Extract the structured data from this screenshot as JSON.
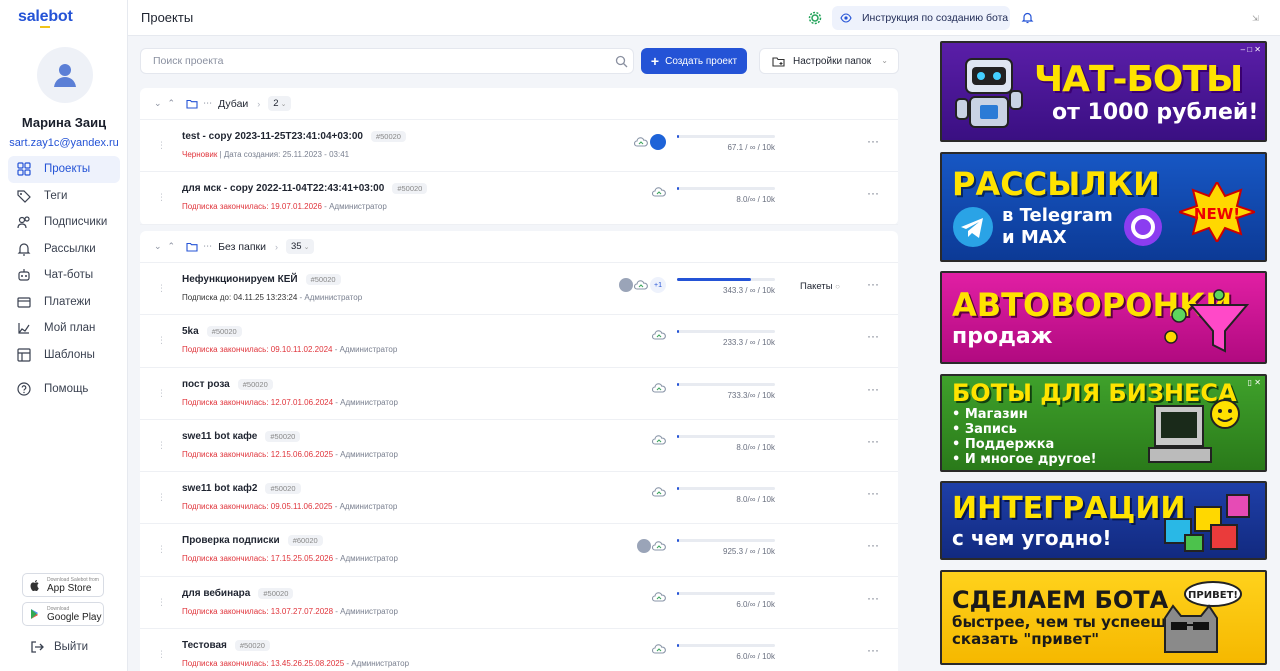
{
  "app": {
    "logo": "salebot"
  },
  "user": {
    "name": "Марина Заиц",
    "email": "sart.zay1c@yandex.ru"
  },
  "nav": [
    {
      "label": "Проекты",
      "icon": "projects-icon",
      "active": true
    },
    {
      "label": "Теги",
      "icon": "tag-icon"
    },
    {
      "label": "Подписчики",
      "icon": "subscribers-icon"
    },
    {
      "label": "Рассылки",
      "icon": "bell-icon"
    },
    {
      "label": "Чат-боты",
      "icon": "chatbot-icon"
    },
    {
      "label": "Платежи",
      "icon": "payments-icon"
    },
    {
      "label": "Мой план",
      "icon": "plan-icon"
    },
    {
      "label": "Шаблоны",
      "icon": "templates-icon"
    }
  ],
  "help": {
    "label": "Помощь"
  },
  "stores": {
    "appstore_small": "Download Salebot from",
    "appstore": "App Store",
    "googleplay_small": "Download",
    "googleplay": "Google Play"
  },
  "logout": "Выйти",
  "header": {
    "title": "Проекты",
    "instruction": "Инструкция по созданию бота"
  },
  "toolbar": {
    "search_placeholder": "Поиск проекта",
    "create": "Создать проект",
    "folders": "Настройки папок"
  },
  "folders": [
    {
      "name": "Дубаи",
      "count": "2",
      "projects": [
        {
          "name": "test - copy 2023-11-25T23:41:04+03:00",
          "id": "#50020",
          "status": "Черновик",
          "sub": " | Дата создания: 25.11.2023 - 03:41",
          "usage": "67.1 / ∞ / 10k",
          "progress": 0.01,
          "bot": true
        },
        {
          "name": "для мск - copy 2022-11-04T22:43:41+03:00",
          "id": "#50020",
          "status": "Подписка закончилась: 19.07.01.2026",
          "sub": " - Администратор",
          "usage": "8.0/∞ / 10k",
          "progress": 0.01
        }
      ]
    },
    {
      "name": "Без папки",
      "count": "35",
      "projects": [
        {
          "name": "Нефункционируем КЕЙ",
          "id": "#50020",
          "status": "",
          "plain": "Подписка до: 04.11.25 13:23:24",
          "sub": " - Администратор",
          "usage": "343.3 / ∞ / 10k",
          "progress": 0.75,
          "avatar": true,
          "plus": "+1",
          "pkg": "Пакеты"
        },
        {
          "name": "5ka",
          "id": "#50020",
          "status": "Подписка закончилась: 09.10.11.02.2024",
          "sub": " - Администратор",
          "usage": "233.3 / ∞ / 10k",
          "progress": 0.01
        },
        {
          "name": "пост роза",
          "id": "#50020",
          "status": "Подписка закончилась: 12.07.01.06.2024",
          "sub": " - Администратор",
          "usage": "733.3/∞ / 10k",
          "progress": 0.01
        },
        {
          "name": "swe11 bot кафе",
          "id": "#50020",
          "status": "Подписка закончилась: 12.15.06.06.2025",
          "sub": " - Администратор",
          "usage": "8.0/∞ / 10k",
          "progress": 0.01
        },
        {
          "name": "swe11 bot каф2",
          "id": "#50020",
          "status": "Подписка закончилась: 09.05.11.06.2025",
          "sub": " - Администратор",
          "usage": "8.0/∞ / 10k",
          "progress": 0.01
        },
        {
          "name": "Проверка подписки",
          "id": "#60020",
          "status": "Подписка закончилась: 17.15.25.05.2026",
          "sub": " - Администратор",
          "usage": "925.3 / ∞ / 10k",
          "progress": 0.01,
          "avatar": true
        },
        {
          "name": "для вебинара",
          "id": "#50020",
          "status": "Подписка закончилась: 13.07.27.07.2028",
          "sub": " - Администратор",
          "usage": "6.0/∞ / 10k",
          "progress": 0.01
        },
        {
          "name": "Тестовая",
          "id": "#50020",
          "status": "Подписка закончилась: 13.45.26.25.08.2025",
          "sub": " - Администратор",
          "usage": "6.0/∞ / 10k",
          "progress": 0.01
        }
      ]
    }
  ],
  "ads": [
    {
      "line1": "ЧАТ-БОТЫ",
      "line2": "от 1000 рублей!"
    },
    {
      "line1": "РАССЫЛКИ",
      "line2a": "в Telegram",
      "line2b": "и MAX",
      "badge": "NEW!"
    },
    {
      "line1": "АВТОВОРОНКИ",
      "line2": "продаж"
    },
    {
      "line1": "БОТЫ ДЛЯ БИЗНЕСА",
      "items": [
        "• Магазин",
        "• Запись",
        "• Поддержка",
        "• И многое другое!"
      ]
    },
    {
      "line1": "ИНТЕГРАЦИИ",
      "line2": "с чем угодно!"
    },
    {
      "line1": "СДЕЛАЕМ БОТА",
      "line2": "быстрее, чем ты успеешь",
      "line3": "сказать \"привет\"",
      "bubble": "ПРИВЕТ!"
    }
  ],
  "colors": {
    "accent": "#2453d6",
    "danger": "#e0343b"
  }
}
